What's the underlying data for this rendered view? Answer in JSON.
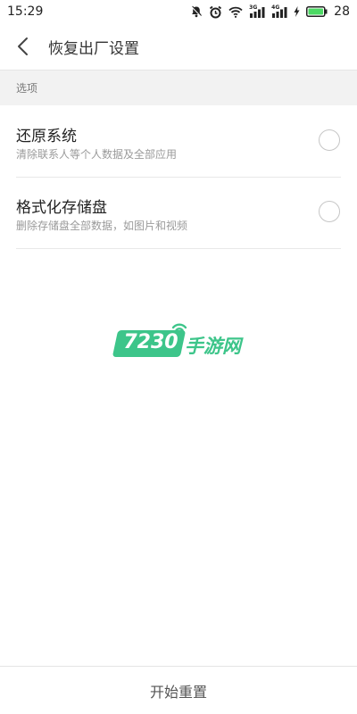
{
  "status_bar": {
    "time": "15:29",
    "network_1": "3G",
    "network_2": "4G",
    "battery": "28",
    "icons": [
      "bell-off-icon",
      "alarm-icon",
      "wifi-icon",
      "signal-3g-icon",
      "signal-4g-icon",
      "charging-icon",
      "battery-icon"
    ]
  },
  "header": {
    "title": "恢复出厂设置",
    "back_icon": "back-arrow-icon"
  },
  "section": {
    "label": "选项"
  },
  "options": [
    {
      "title": "还原系统",
      "subtitle": "清除联系人等个人数据及全部应用",
      "selected": false
    },
    {
      "title": "格式化存储盘",
      "subtitle": "删除存储盘全部数据，如图片和视频",
      "selected": false
    }
  ],
  "watermark": {
    "number": "7230",
    "text": "手游网"
  },
  "footer": {
    "button_label": "开始重置"
  },
  "colors": {
    "accent": "#3dc58a",
    "battery": "#4cd964",
    "section_bg": "#f2f2f2"
  }
}
